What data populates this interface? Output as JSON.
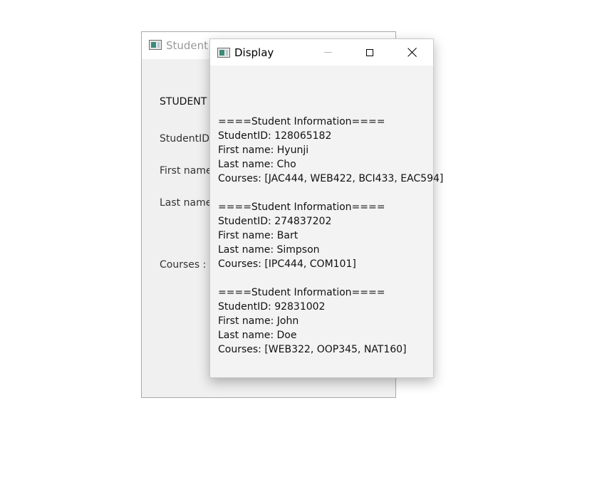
{
  "back_window": {
    "title": "Student M",
    "labels": {
      "heading": "STUDENT I",
      "student_id": "StudentID",
      "first_name": "First name",
      "last_name": "Last name",
      "courses": "Courses :"
    }
  },
  "display_window": {
    "title": "Display",
    "content": "====Student Information====\nStudentID: 128065182\nFirst name: Hyunji\nLast name: Cho\nCourses: [JAC444, WEB422, BCI433, EAC594]\n\n====Student Information====\nStudentID: 274837202\nFirst name: Bart\nLast name: Simpson\nCourses: [IPC444, COM101]\n\n====Student Information====\nStudentID: 92831002\nFirst name: John\nLast name: Doe\nCourses: [WEB322, OOP345, NAT160]"
  },
  "icons": {
    "app": "app-window-icon",
    "minimize": "minimize-icon",
    "maximize": "maximize-icon",
    "close": "close-icon"
  }
}
